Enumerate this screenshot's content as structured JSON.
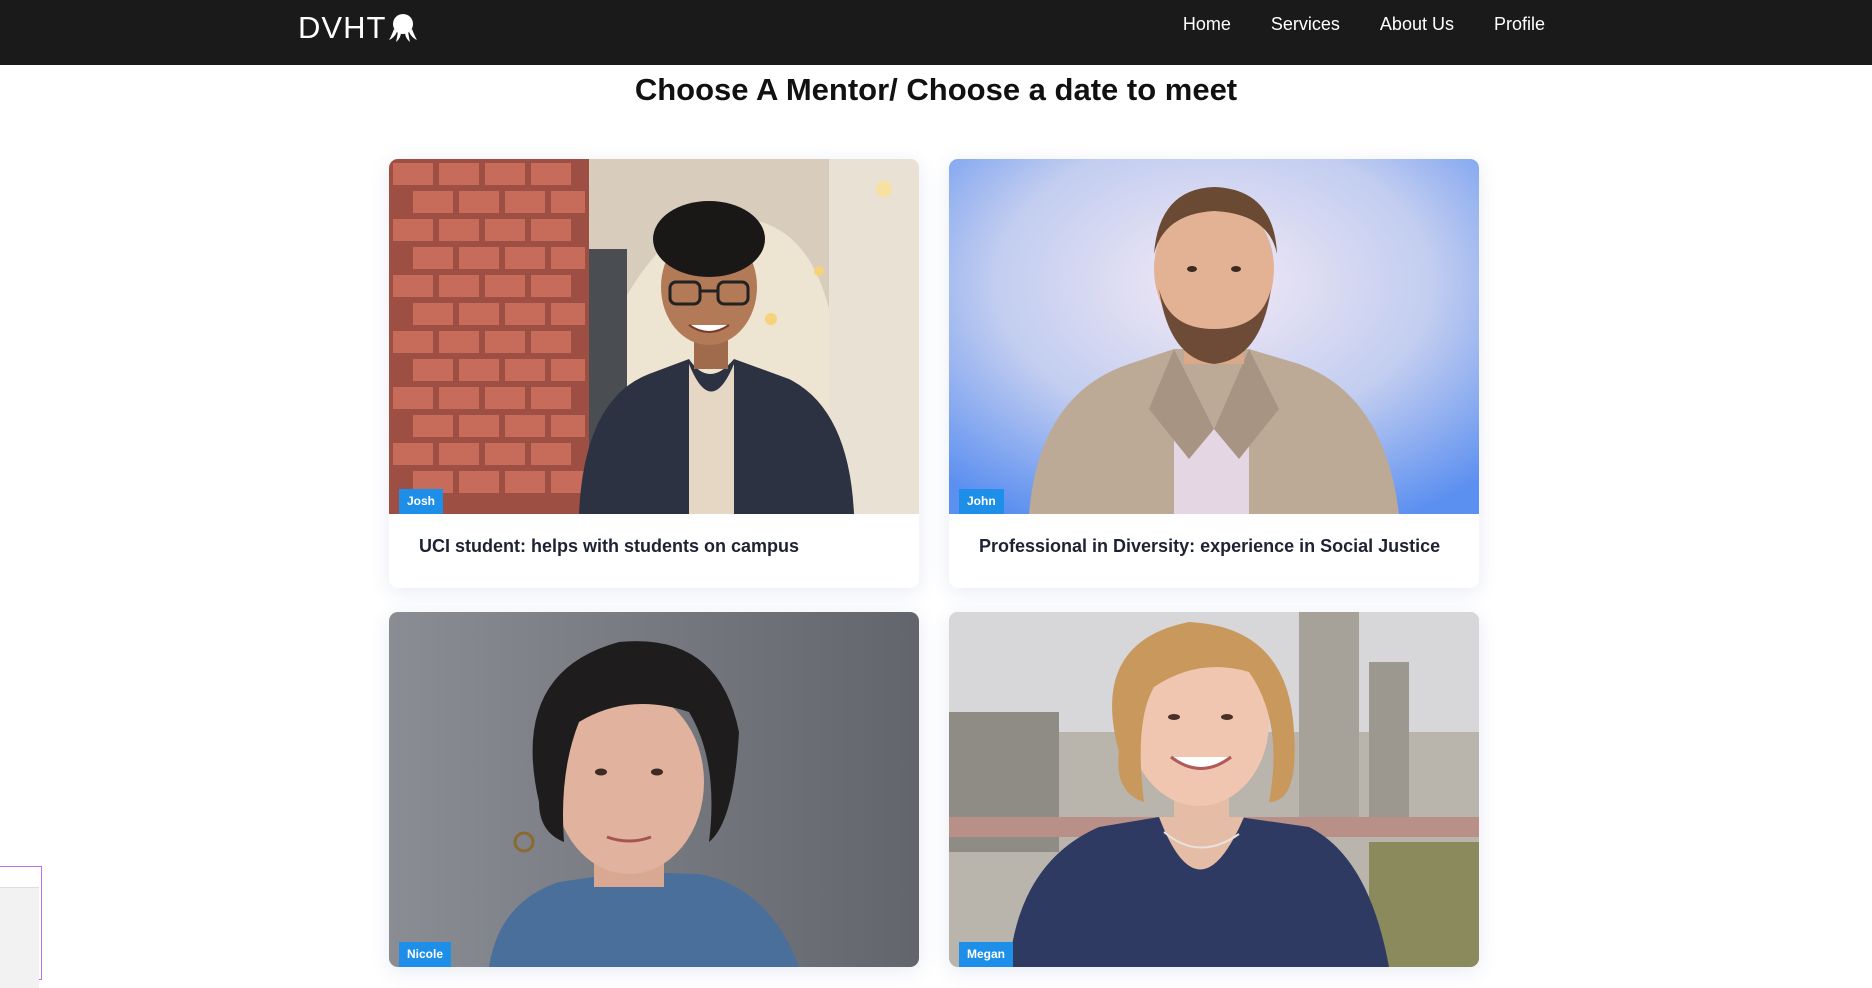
{
  "brand": {
    "name": "DVHT",
    "logo_icon": "octopus-icon"
  },
  "nav": {
    "links": [
      "Home",
      "Services",
      "About Us",
      "Profile"
    ]
  },
  "page": {
    "title": "Choose A Mentor/ Choose a date to meet"
  },
  "mentors": [
    {
      "name": "Josh",
      "description": "UCI student: helps with students on campus"
    },
    {
      "name": "John",
      "description": "Professional in Diversity: experience in Social Justice"
    },
    {
      "name": "Nicole",
      "description": ""
    },
    {
      "name": "Megan",
      "description": ""
    }
  ],
  "colors": {
    "navbar": "#1a1a1a",
    "badge": "#1e8fe8"
  }
}
